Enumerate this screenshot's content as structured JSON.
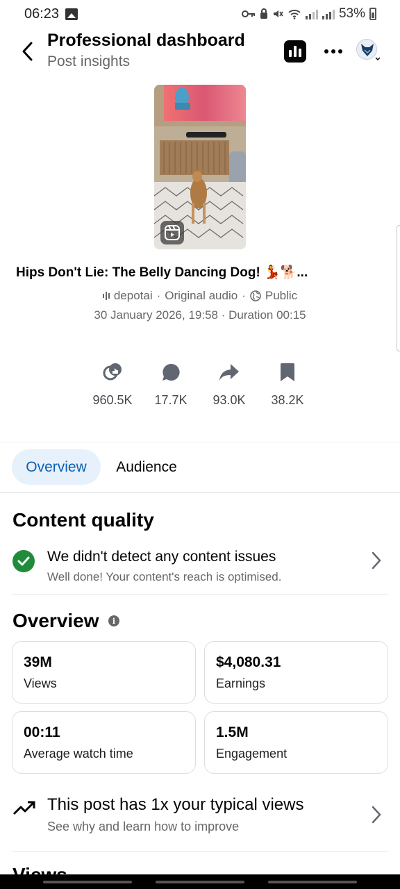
{
  "status_bar": {
    "time": "06:23",
    "battery": "53%"
  },
  "header": {
    "title": "Professional dashboard",
    "subtitle": "Post insights"
  },
  "post": {
    "title": "Hips Don't Lie: The Belly Dancing Dog! 💃🐕...",
    "author": "depotai",
    "audio": "Original audio",
    "visibility": "Public",
    "date_duration": "30 January 2026, 19:58 · Duration 00:15"
  },
  "stats": [
    {
      "icon": "reaction-icon",
      "value": "960.5K"
    },
    {
      "icon": "comment-icon",
      "value": "17.7K"
    },
    {
      "icon": "share-icon",
      "value": "93.0K"
    },
    {
      "icon": "bookmark-icon",
      "value": "38.2K"
    }
  ],
  "tabs": {
    "overview": "Overview",
    "audience": "Audience"
  },
  "content_quality": {
    "heading": "Content quality",
    "title": "We didn't detect any content issues",
    "subtitle": "Well done! Your content's reach is optimised."
  },
  "overview": {
    "heading": "Overview",
    "cards": [
      {
        "value": "39M",
        "label": "Views"
      },
      {
        "value": "$4,080.31",
        "label": "Earnings"
      },
      {
        "value": "00:11",
        "label": "Average watch time"
      },
      {
        "value": "1.5M",
        "label": "Engagement"
      }
    ],
    "trend_title": "This post has 1x your typical views",
    "trend_subtitle": "See why and learn how to improve"
  },
  "next_section": {
    "heading": "Views"
  },
  "colors": {
    "accent": "#0a5fb4",
    "accent_bg": "#e7f1fb",
    "success": "#1f8b3b"
  }
}
